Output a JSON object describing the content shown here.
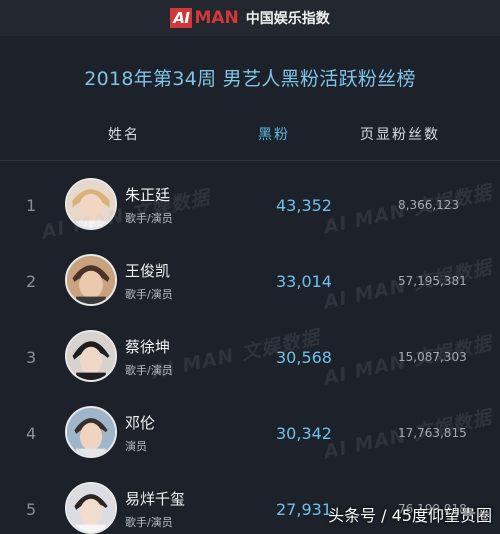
{
  "brand": {
    "ai": "AI",
    "man": "MAN",
    "cn": "中国娱乐指数"
  },
  "title": "2018年第34周 男艺人黑粉活跃粉丝榜",
  "columns": {
    "name": "姓名",
    "black_fans": "黑粉",
    "page_fans": "页显粉丝数"
  },
  "rows": [
    {
      "rank": "1",
      "name": "朱正廷",
      "role": "歌手/演员",
      "black_fans": "43,352",
      "page_fans": "8,366,123"
    },
    {
      "rank": "2",
      "name": "王俊凯",
      "role": "歌手/演员",
      "black_fans": "33,014",
      "page_fans": "57,195,381"
    },
    {
      "rank": "3",
      "name": "蔡徐坤",
      "role": "歌手/演员",
      "black_fans": "30,568",
      "page_fans": "15,087,303"
    },
    {
      "rank": "4",
      "name": "邓伦",
      "role": "演员",
      "black_fans": "30,342",
      "page_fans": "17,763,815"
    },
    {
      "rank": "5",
      "name": "易烊千玺",
      "role": "歌手/演员",
      "black_fans": "27,931",
      "page_fans": "76,199,018"
    }
  ],
  "watermark": "AI MAN 文娱数据",
  "footer_mark": "头条号 / 45度仰望贵圈",
  "colors": {
    "accent": "#d23838",
    "title": "#7fc3e6",
    "black_fans": "#6fc0ea",
    "background": "#1c212a"
  }
}
